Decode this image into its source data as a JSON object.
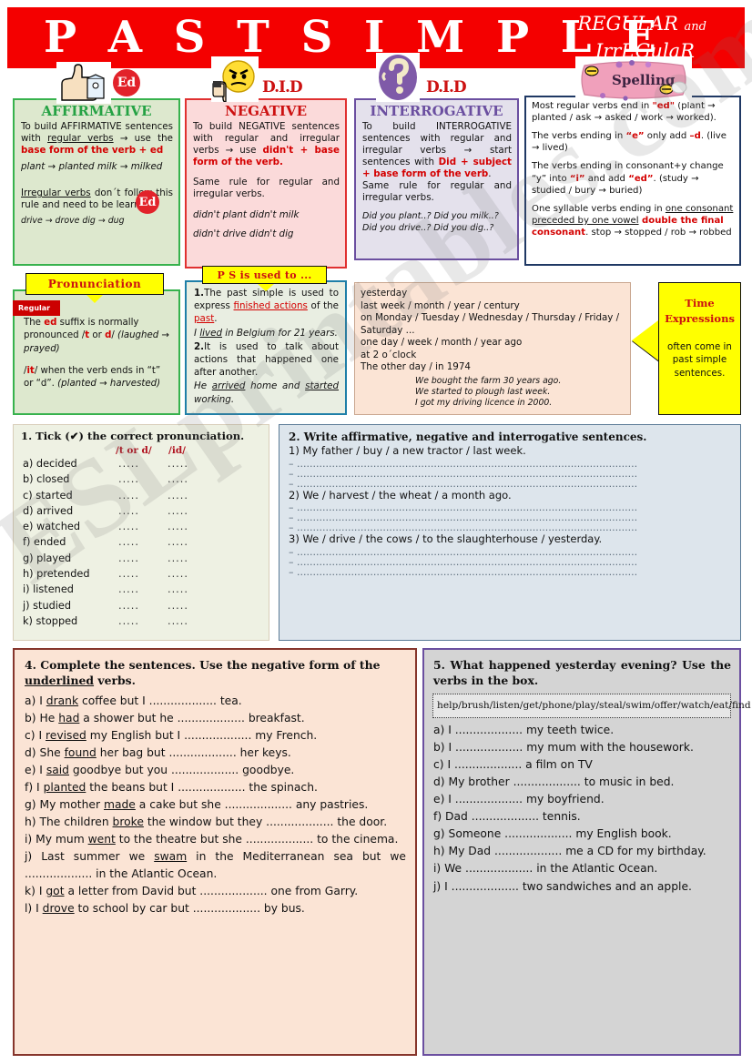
{
  "banner": {
    "title": "P A S T   S I M P L E",
    "sub_regular": "REGULAR",
    "sub_and": "and",
    "sub_irregular": "IrrEGulaR"
  },
  "clipart": {
    "thumbs_up": "thumbs-up-ed-icon",
    "ed_badge": "Ed",
    "angry_face": "angry-face-thumbs-down-icon",
    "did_label_1": "D.I.D",
    "question_mark": "question-mark-icon",
    "did_label_2": "D.I.D",
    "spelling_sign": "Spelling"
  },
  "affirmative": {
    "title": "AFFIRMATIVE",
    "p1_a": "To build AFFIRMATIVE sentences with ",
    "p1_underline": "regular verbs",
    "p1_b": " → use the ",
    "p1_red": "base form of the verb + ed",
    "p1_examples": "plant → planted   milk → milked",
    "p2_underline": "Irregular verbs",
    "p2_a": " don´t follow this rule and need to be learned.",
    "p2_examples": "drive → drove    dig → dug",
    "ed_badge": "Ed"
  },
  "negative": {
    "title": "NEGATIVE",
    "p1_a": "To build NEGATIVE sentences with regular and irregular verbs → use ",
    "p1_red": "didn't + base form of the verb.",
    "p2": "Same rule for regular and irregular verbs.",
    "ex1": "didn't plant      didn't milk",
    "ex2": "didn't drive      didn't dig"
  },
  "interrogative": {
    "title": "INTERROGATIVE",
    "p1_a": "To build INTERROGATIVE sentences with regular and irregular verbs → start sentences with ",
    "p1_red": "Did + subject + base form of the verb",
    "p1_b": ".",
    "p2": "Same rule for regular and irregular verbs.",
    "ex1": "Did you plant..?  Did you milk..?",
    "ex2": "Did you drive..?  Did you dig..?"
  },
  "spelling": {
    "label": "Spelling",
    "r1_a": "Most regular verbs end in ",
    "r1_red": "\"ed\"",
    "r1_b": " (plant → planted / ask → asked / work → worked).",
    "r2_a": "The verbs ending in ",
    "r2_red1": "“e”",
    "r2_b": " only add ",
    "r2_red2": "–d",
    "r2_c": ". (live → lived)",
    "r3_a": "The verbs ending in consonant+y change “y” into ",
    "r3_red1": "“i”",
    "r3_b": " and add ",
    "r3_red2": "“ed”",
    "r3_c": ". (study → studied / bury → buried)",
    "r4_a": "One syllable verbs ending in ",
    "r4_u": "one consonant preceded by one vowel",
    "r4_red": " double the final consonant",
    "r4_b": ". stop → stopped / rob → robbed"
  },
  "pronunciation": {
    "callout": "Pronunciation",
    "tag": "Regular",
    "p1_a": "The ",
    "p1_red": "ed",
    "p1_b": " suffix is normally pronounced /",
    "p1_red2": "t",
    "p1_c": " or ",
    "p1_red3": "d",
    "p1_d": "/ ",
    "p1_italic": "(laughed → prayed)",
    "p2_a": "/",
    "p2_red": "it",
    "p2_b": "/ when the verb ends in “t” or “d”. ",
    "p2_italic": "(planted → harvested)"
  },
  "past_simple_use": {
    "callout": "P S is used to ...",
    "n1": "1.",
    "n1_a": "The past simple is used to express ",
    "n1_red": "finished actions",
    "n1_b": " of the ",
    "n1_red2": "past",
    "n1_c": ".",
    "n1_example_a": "I ",
    "n1_example_u": "lived",
    "n1_example_b": " in Belgium for 21 years.",
    "n2": "2.",
    "n2_a": "It is used to talk about actions that happened one after another.",
    "n2_example_a": "He ",
    "n2_example_u1": "arrived",
    "n2_example_b": " home and ",
    "n2_example_u2": "started",
    "n2_example_c": " working."
  },
  "time_expressions": {
    "label_title": "Time Expressions",
    "label_sub": "often come in past simple sentences.",
    "lines": [
      "yesterday",
      "last week / month / year / century",
      "on  Monday / Tuesday / Wednesday / Thursday / Friday / Saturday ...",
      "one day / week / month / year ago",
      "at 2 o´clock",
      "The other day / in 1974"
    ],
    "examples": [
      "We bought the farm 30 years ago.",
      "We started to plough last week.",
      "I got my driving licence in 2000."
    ]
  },
  "exercise1": {
    "heading": "1. Tick (✔) the correct pronunciation.",
    "col1": "/t or d/",
    "col2": "/id/",
    "dots": ".....",
    "items": [
      "a) decided",
      "b) closed",
      "c) started",
      "d) arrived",
      "e) watched",
      "f) ended",
      "g) played",
      "h) pretended",
      "i) listened",
      "j) studied",
      "k) stopped"
    ]
  },
  "exercise2": {
    "heading": "2. Write affirmative, negative and interrogative sentences.",
    "blank": "– ...........................................................................................................",
    "prompts": [
      "1) My father / buy / a new tractor / last week.",
      "2) We / harvest / the wheat / a month ago.",
      "3) We / drive / the cows / to the slaughterhouse / yesterday."
    ]
  },
  "exercise4": {
    "heading_a": "4. Complete the sentences. Use the negative form of the ",
    "heading_u": "underlined",
    "heading_b": " verbs.",
    "items": [
      {
        "pre": "a) I ",
        "verb": "drank",
        "post": " coffee but I ................... tea."
      },
      {
        "pre": "b) He ",
        "verb": "had",
        "post": " a shower but he ................... breakfast."
      },
      {
        "pre": "c) I ",
        "verb": "revised",
        "post": " my English but I ................... my French."
      },
      {
        "pre": "d) She ",
        "verb": "found",
        "post": " her bag but ................... her keys."
      },
      {
        "pre": "e) I ",
        "verb": "said",
        "post": " goodbye but you ................... goodbye."
      },
      {
        "pre": "f) I ",
        "verb": "planted",
        "post": " the beans but I ................... the spinach."
      },
      {
        "pre": "g) My mother ",
        "verb": "made",
        "post": " a cake but she ................... any pastries."
      },
      {
        "pre": "h) The children ",
        "verb": "broke",
        "post": " the window but they ................... the door."
      },
      {
        "pre": "i) My mum ",
        "verb": "went",
        "post": " to the theatre but she ................... to the cinema."
      },
      {
        "pre": "j) Last summer we ",
        "verb": "swam",
        "post": " in the Mediterranean sea but we ................... in the Atlantic Ocean."
      },
      {
        "pre": "k) I ",
        "verb": "got",
        "post": " a letter from David but ................... one from Garry."
      },
      {
        "pre": "l) I ",
        "verb": "drove",
        "post": " to school by car but ................... by bus."
      }
    ]
  },
  "exercise5": {
    "heading": "5. What happened yesterday evening? Use the verbs in the box.",
    "verb_box": "help/brush/listen/get/phone/play/steal/swim/offer/watch/eat/find",
    "items": [
      "a) I ................... my teeth twice.",
      "b) I ................... my mum with the housework.",
      "c) I ................... a film on TV",
      "d) My brother ................... to music in bed.",
      "e) I ................... my boyfriend.",
      "f) Dad ................... tennis.",
      "g) Someone ................... my English book.",
      "h) My Dad ................... me a CD for my birthday.",
      "i) We ................... in the Atlantic Ocean.",
      "j) I ................... two sandwiches and an apple."
    ]
  },
  "watermark": {
    "text": "ESLprintables.com"
  },
  "colors": {
    "banner_red": "#f40000",
    "affirmative_green": "#25a244",
    "negative_red": "#cc1111",
    "interrogative_purple": "#6b4fa0",
    "accent_yellow": "#ffff00",
    "spelling_border": "#1f3864"
  }
}
